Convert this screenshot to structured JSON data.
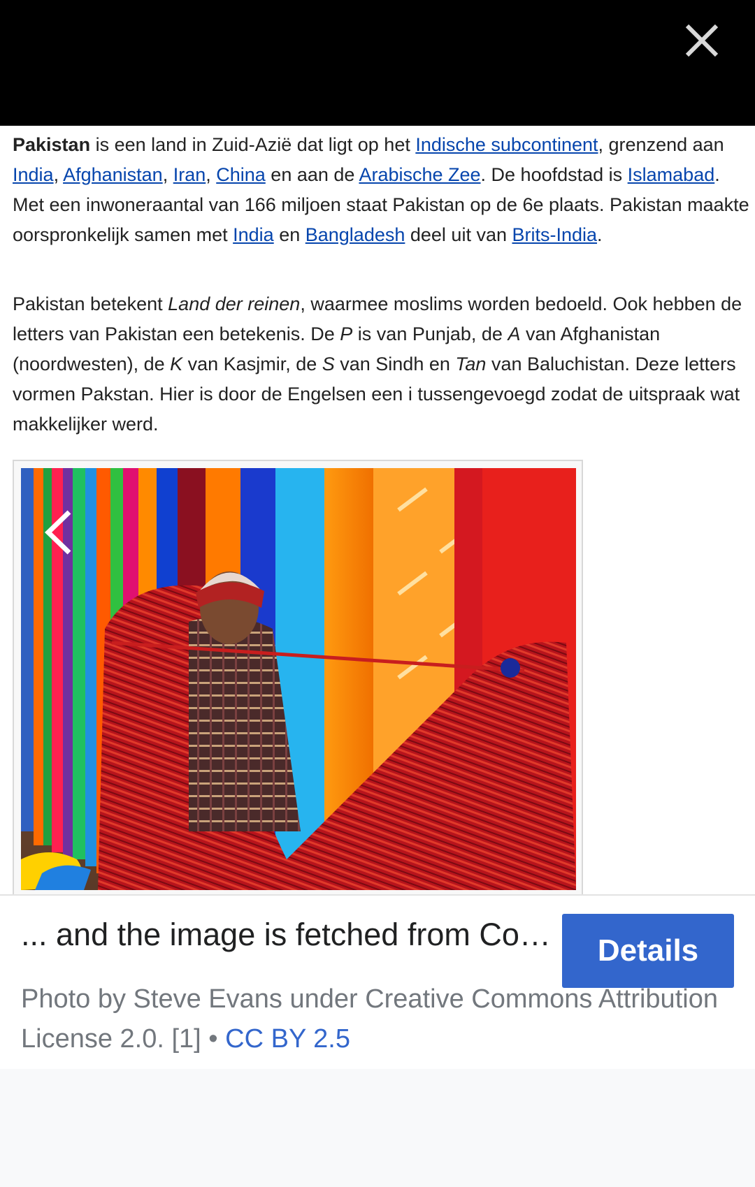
{
  "close_label": "Close",
  "article": {
    "p1": {
      "b1": "Pakistan",
      "t1": " is een land in Zuid-Azië dat ligt op het ",
      "l1": "Indische subcontinent",
      "t2": ", grenzend aan ",
      "l2": "India",
      "t3": ", ",
      "l3": "Afghanistan",
      "t4": ", ",
      "l4": "Iran",
      "t5": ", ",
      "l5": "China",
      "t6": " en aan de ",
      "l6": "Arabische Zee",
      "t7": ". De hoofdstad is ",
      "l7": "Islamabad",
      "t8": ". Met een inwoneraantal van 166 miljoen staat Pakistan op de 6e plaats. Pakistan maakte oorspronkelijk samen met ",
      "l8": "India",
      "t9": " en ",
      "l9": "Bangladesh",
      "t10": " deel uit van ",
      "l10": "Brits-India",
      "t11": "."
    },
    "p2": {
      "t1": "Pakistan betekent ",
      "i1": "Land der reinen",
      "t2": ", waarmee moslims worden bedoeld. Ook hebben de letters van Pakistan een betekenis. De ",
      "i2": "P",
      "t3": " is van Punjab, de ",
      "i3": "A",
      "t4": " van Afghanistan (noordwesten), de ",
      "i4": "K",
      "t5": " van Kasjmir, de ",
      "i5": "S",
      "t6": " van Sindh en ",
      "i6": "Tan",
      "t7": " van Baluchistan. Deze letters vormen Pakstan. Hier is door de Engelsen een i tussengevoegd zodat de uitspraak wat makkelijker werd."
    }
  },
  "media": {
    "caption": "... and the image is fetched from Commons",
    "details_label": "Details",
    "attribution": "Photo by Steve Evans under Creative Commons Attribution License 2.0. [1]",
    "separator": " • ",
    "license": "CC BY 2.5"
  },
  "colors": {
    "link": "#0645ad",
    "button": "#3366cc",
    "topbar": "#000000"
  },
  "icons": [
    "close-icon",
    "chevron-left-icon",
    "chevron-right-icon"
  ]
}
